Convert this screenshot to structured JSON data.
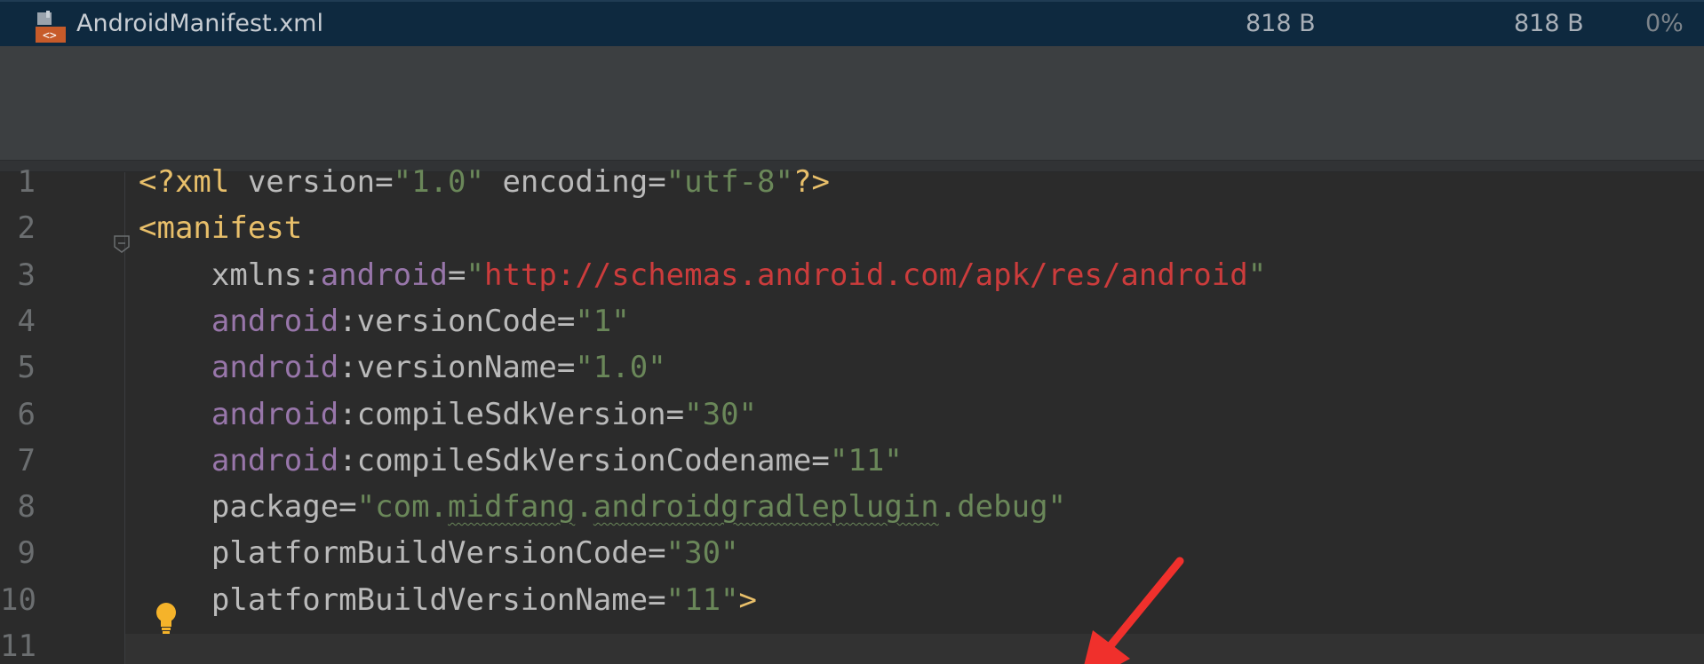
{
  "file_row": {
    "name": "AndroidManifest.xml",
    "raw_size": "818 B",
    "download_size": "818 B",
    "percent": "0%"
  },
  "editor": {
    "line_numbers": [
      "1",
      "2",
      "3",
      "4",
      "5",
      "6",
      "7",
      "8",
      "9",
      "10",
      "11"
    ],
    "lines": [
      [
        {
          "t": "<?xml ",
          "c": "tag"
        },
        {
          "t": "version",
          "c": "attr"
        },
        {
          "t": "=",
          "c": "punc"
        },
        {
          "t": "\"1.0\"",
          "c": "val"
        },
        {
          "t": " ",
          "c": "punc"
        },
        {
          "t": "encoding",
          "c": "attr"
        },
        {
          "t": "=",
          "c": "punc"
        },
        {
          "t": "\"utf-8\"",
          "c": "val"
        },
        {
          "t": "?>",
          "c": "tag"
        }
      ],
      [
        {
          "t": "<manifest",
          "c": "tag"
        }
      ],
      [
        {
          "t": "    xmlns:",
          "c": "attr"
        },
        {
          "t": "android",
          "c": "ns"
        },
        {
          "t": "=",
          "c": "punc"
        },
        {
          "t": "\"",
          "c": "val"
        },
        {
          "t": "http://schemas.android.com/apk/res/android",
          "c": "url"
        },
        {
          "t": "\"",
          "c": "val"
        }
      ],
      [
        {
          "t": "    ",
          "c": "punc"
        },
        {
          "t": "android",
          "c": "ns"
        },
        {
          "t": ":versionCode",
          "c": "attr"
        },
        {
          "t": "=",
          "c": "punc"
        },
        {
          "t": "\"1\"",
          "c": "val"
        }
      ],
      [
        {
          "t": "    ",
          "c": "punc"
        },
        {
          "t": "android",
          "c": "ns"
        },
        {
          "t": ":versionName",
          "c": "attr"
        },
        {
          "t": "=",
          "c": "punc"
        },
        {
          "t": "\"1.0\"",
          "c": "val"
        }
      ],
      [
        {
          "t": "    ",
          "c": "punc"
        },
        {
          "t": "android",
          "c": "ns"
        },
        {
          "t": ":compileSdkVersion",
          "c": "attr"
        },
        {
          "t": "=",
          "c": "punc"
        },
        {
          "t": "\"30\"",
          "c": "val"
        }
      ],
      [
        {
          "t": "    ",
          "c": "punc"
        },
        {
          "t": "android",
          "c": "ns"
        },
        {
          "t": ":compileSdkVersionCodename",
          "c": "attr"
        },
        {
          "t": "=",
          "c": "punc"
        },
        {
          "t": "\"11\"",
          "c": "val"
        }
      ],
      [
        {
          "t": "    package",
          "c": "attr"
        },
        {
          "t": "=",
          "c": "punc"
        },
        {
          "t": "\"com.",
          "c": "val"
        },
        {
          "t": "midfang",
          "c": "val-squig"
        },
        {
          "t": ".",
          "c": "val"
        },
        {
          "t": "androidgradleplugin",
          "c": "val-squig"
        },
        {
          "t": ".debug\"",
          "c": "val"
        }
      ],
      [
        {
          "t": "    platformBuildVersionCode",
          "c": "attr"
        },
        {
          "t": "=",
          "c": "punc"
        },
        {
          "t": "\"30\"",
          "c": "val"
        }
      ],
      [
        {
          "t": "    platformBuildVersionName",
          "c": "attr"
        },
        {
          "t": "=",
          "c": "punc"
        },
        {
          "t": "\"11\"",
          "c": "val"
        },
        {
          "t": ">",
          "c": "tag"
        }
      ],
      []
    ]
  },
  "colors": {
    "tag": "#e8bf6a",
    "attr": "#bababa",
    "namespace": "#9876aa",
    "value": "#6a8759",
    "url": "#cc3c3c",
    "arrow": "#f0302c"
  },
  "icons": {
    "file_icon": "xml-file-icon",
    "fold_icon": "fold-marker-icon",
    "intention_icon": "lightbulb-icon",
    "annotation": "red-arrow-icon"
  }
}
